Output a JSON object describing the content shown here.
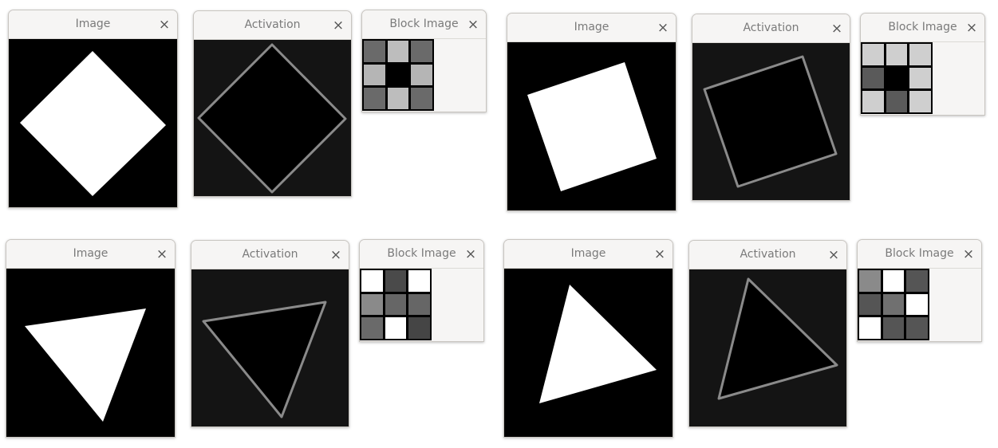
{
  "windows": {
    "image_title": "Image",
    "activation_title": "Activation",
    "block_title": "Block Image",
    "close_glyph": "×"
  },
  "groups": [
    {
      "shape": "diamond",
      "block_cells": [
        "#6a6a6a",
        "#bdbdbd",
        "#6a6a6a",
        "#b5b5b5",
        "#000000",
        "#b5b5b5",
        "#6a6a6a",
        "#bdbdbd",
        "#6a6a6a"
      ]
    },
    {
      "shape": "rotated-square",
      "block_cells": [
        "#cfcfcf",
        "#cfcfcf",
        "#cfcfcf",
        "#5a5a5a",
        "#000000",
        "#cfcfcf",
        "#cfcfcf",
        "#5a5a5a",
        "#cfcfcf"
      ]
    },
    {
      "shape": "triangle-1",
      "block_cells": [
        "#ffffff",
        "#4a4a4a",
        "#ffffff",
        "#8a8a8a",
        "#666666",
        "#666666",
        "#6a6a6a",
        "#ffffff",
        "#454545"
      ]
    },
    {
      "shape": "triangle-2",
      "block_cells": [
        "#8a8a8a",
        "#ffffff",
        "#555555",
        "#555555",
        "#707070",
        "#ffffff",
        "#ffffff",
        "#555555",
        "#555555"
      ]
    }
  ],
  "colors": {
    "image_bg": "#000000",
    "shape_fill": "#ffffff",
    "activation_bg": "#141414"
  }
}
